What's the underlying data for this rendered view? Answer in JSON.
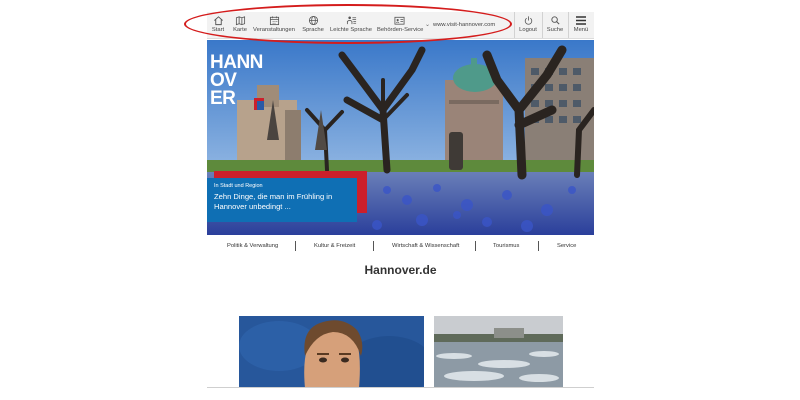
{
  "toolbar": {
    "items": [
      {
        "label": "Start",
        "icon": "home-icon"
      },
      {
        "label": "Karte",
        "icon": "map-icon"
      },
      {
        "label": "Veranstaltungen",
        "icon": "calendar-icon"
      },
      {
        "label": "Sprache",
        "icon": "globe-icon"
      },
      {
        "label": "Leichte Sprache",
        "icon": "easy-language-icon"
      },
      {
        "label": "Behörden-Service",
        "icon": "id-card-icon"
      }
    ],
    "url": "www.visit-hannover.com",
    "logout": "Logout",
    "search": "Suche",
    "menu": "Menü"
  },
  "hero": {
    "logo_lines": [
      "HANN",
      "OV",
      "ER"
    ],
    "teaser_kicker": "In Stadt und Region",
    "teaser_headline": "Zehn Dinge, die man im Frühling in Hannover unbedingt ..."
  },
  "categories": [
    "Politik & Verwaltung",
    "Kultur & Freizeit",
    "Wirtschaft & Wissenschaft",
    "Tourismus",
    "Service"
  ],
  "site_title": "Hannover.de",
  "colors": {
    "brand_red": "#cc1f2b",
    "teaser_blue": "#0f6fb4",
    "annotation_red": "#d41c1c",
    "toolbar_bg": "#f2f2f2"
  }
}
